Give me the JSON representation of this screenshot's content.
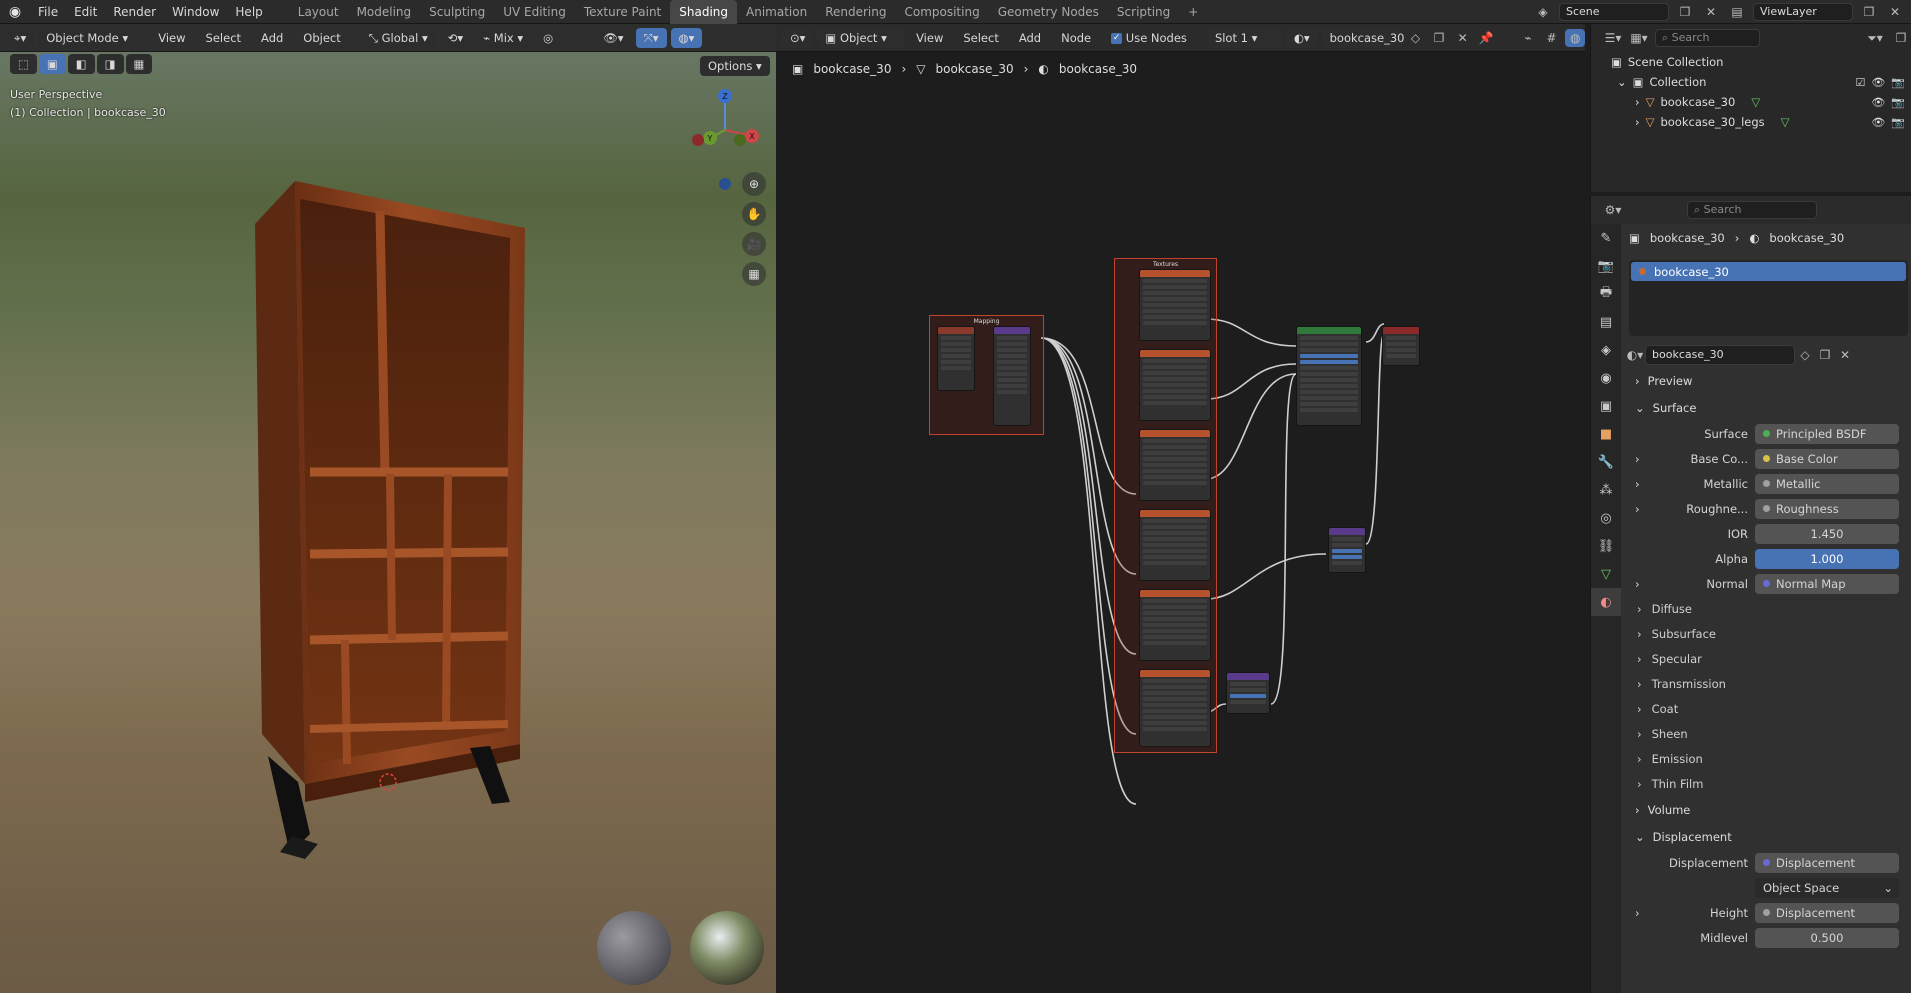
{
  "topbar": {
    "menus": [
      "File",
      "Edit",
      "Render",
      "Window",
      "Help"
    ],
    "workspaces": [
      "Layout",
      "Modeling",
      "Sculpting",
      "UV Editing",
      "Texture Paint",
      "Shading",
      "Animation",
      "Rendering",
      "Compositing",
      "Geometry Nodes",
      "Scripting"
    ],
    "active_workspace": "Shading",
    "add_tab": "+",
    "scene": "Scene",
    "view_layer": "ViewLayer"
  },
  "viewport": {
    "mode": "Object Mode",
    "menus": [
      "View",
      "Select",
      "Add",
      "Object"
    ],
    "transform_orientation": "Global",
    "snap_mode": "Mix",
    "options_label": "Options",
    "info_line1": "User Perspective",
    "info_line2": "(1) Collection | bookcase_30",
    "gizmo_axes": {
      "z": "Z",
      "y": "Y",
      "x": "X"
    }
  },
  "node_editor": {
    "type": "Object",
    "menus": [
      "View",
      "Select",
      "Add",
      "Node"
    ],
    "use_nodes_label": "Use Nodes",
    "slot": "Slot 1",
    "material": "bookcase_30",
    "breadcrumb": [
      "bookcase_30",
      "bookcase_30",
      "bookcase_30"
    ],
    "frame_titles": {
      "mapping": "Mapping",
      "textures": "Textures"
    }
  },
  "outliner": {
    "search_placeholder": "Search",
    "scene_collection": "Scene Collection",
    "collection": "Collection",
    "objects": [
      "bookcase_30",
      "bookcase_30_legs"
    ]
  },
  "properties": {
    "search_placeholder": "Search",
    "breadcrumb": [
      "bookcase_30",
      "bookcase_30"
    ],
    "material_slot": "bookcase_30",
    "material_name": "bookcase_30",
    "preview": "Preview",
    "surface_section": "Surface",
    "surface": {
      "label": "Surface",
      "value": "Principled BSDF"
    },
    "inputs": [
      {
        "label": "Base Co...",
        "value": "Base Color"
      },
      {
        "label": "Metallic",
        "value": "Metallic"
      },
      {
        "label": "Roughne...",
        "value": "Roughness"
      }
    ],
    "ior": {
      "label": "IOR",
      "value": "1.450"
    },
    "alpha": {
      "label": "Alpha",
      "value": "1.000"
    },
    "normal": {
      "label": "Normal",
      "value": "Normal Map"
    },
    "subpanels": [
      "Diffuse",
      "Subsurface",
      "Specular",
      "Transmission",
      "Coat",
      "Sheen",
      "Emission",
      "Thin Film"
    ],
    "volume": "Volume",
    "displacement_section": "Displacement",
    "displacement": {
      "label": "Displacement",
      "value": "Displacement"
    },
    "space": "Object Space",
    "height": {
      "label": "Height",
      "value": "Displacement"
    },
    "midlevel": {
      "label": "Midlevel",
      "value": "0.500"
    }
  }
}
